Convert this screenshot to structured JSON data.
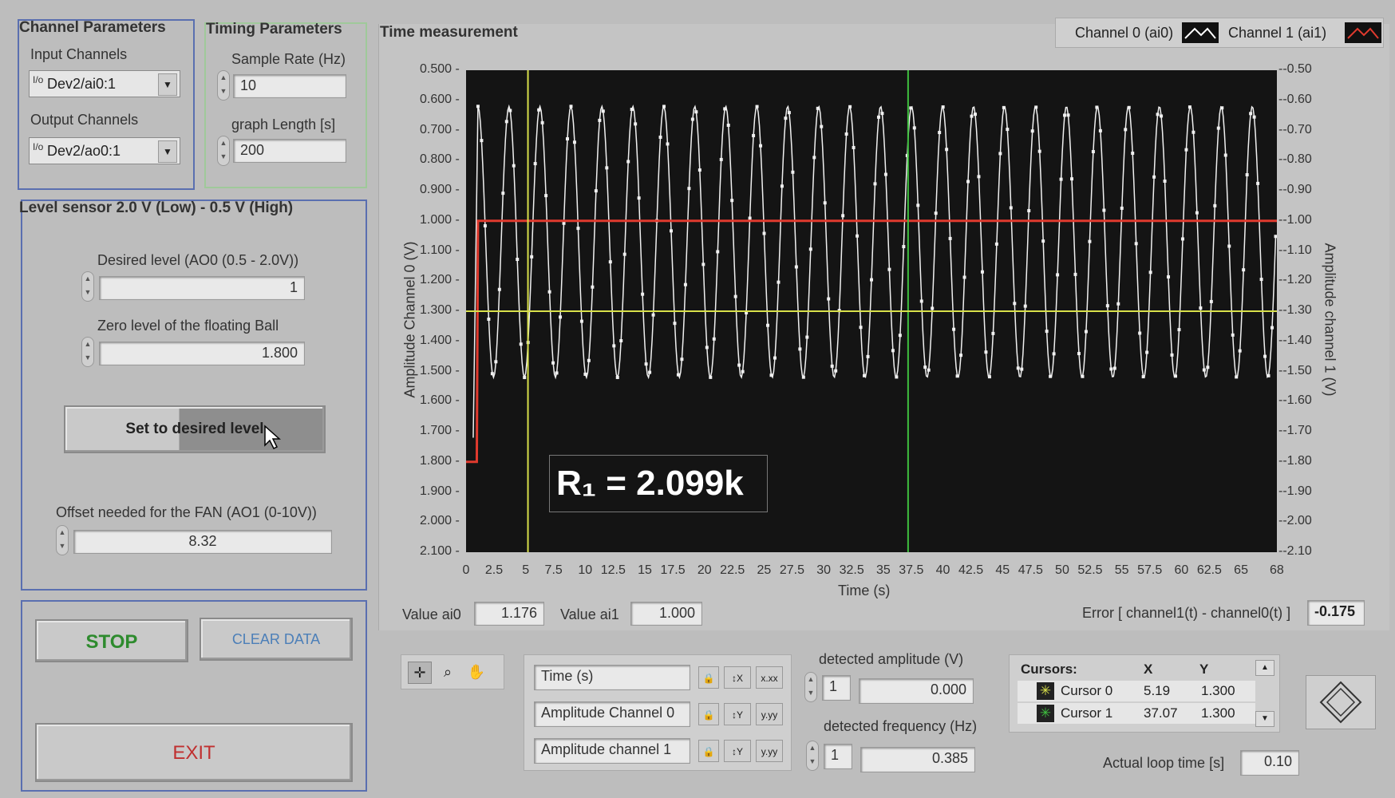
{
  "channel_params": {
    "title": "Channel Parameters",
    "input_label": "Input Channels",
    "input_value": "Dev2/ai0:1",
    "output_label": "Output Channels",
    "output_value": "Dev2/ao0:1"
  },
  "timing_params": {
    "title": "Timing Parameters",
    "sample_rate_label": "Sample Rate (Hz)",
    "sample_rate_value": "10",
    "graph_length_label": "graph Length [s]",
    "graph_length_value": "200"
  },
  "level_panel": {
    "title": "Level sensor 2.0 V (Low) - 0.5 V (High)",
    "desired_label": "Desired level (AO0  (0.5 - 2.0V))",
    "desired_value": "1",
    "zero_label": "Zero level of the floating Ball",
    "zero_value": "1.800",
    "set_button": "Set to desired level",
    "offset_label": "Offset needed for the FAN (AO1  (0-10V))",
    "offset_value": "8.32"
  },
  "buttons": {
    "stop": "STOP",
    "clear": "CLEAR DATA",
    "exit": "EXIT"
  },
  "graph": {
    "title": "Time measurement",
    "legend0": "Channel 0 (ai0)",
    "legend1": "Channel 1 (ai1)",
    "ylabel_left": "Amplitude Channel 0 (V)",
    "ylabel_right": "Amplitude channel 1 (V)",
    "xlabel": "Time (s)",
    "overlay_text": "R₁ = 2.099k",
    "left_ticks": [
      "0.500",
      "0.600",
      "0.700",
      "0.800",
      "0.900",
      "1.000",
      "1.100",
      "1.200",
      "1.300",
      "1.400",
      "1.500",
      "1.600",
      "1.700",
      "1.800",
      "1.900",
      "2.000",
      "2.100"
    ],
    "right_ticks": [
      "-0.50",
      "-0.60",
      "-0.70",
      "-0.80",
      "-0.90",
      "-1.00",
      "-1.10",
      "-1.20",
      "-1.30",
      "-1.40",
      "-1.50",
      "-1.60",
      "-1.70",
      "-1.80",
      "-1.90",
      "-2.00",
      "-2.10"
    ],
    "x_ticks": [
      "0",
      "2.5",
      "5",
      "7.5",
      "10",
      "12.5",
      "15",
      "17.5",
      "20",
      "22.5",
      "25",
      "27.5",
      "30",
      "32.5",
      "35",
      "37.5",
      "40",
      "42.5",
      "45",
      "47.5",
      "50",
      "52.5",
      "55",
      "57.5",
      "60",
      "62.5",
      "65",
      "68"
    ],
    "colors": {
      "background": "#141414",
      "ch0": "#f0f0f0",
      "ch1": "#e03a2e",
      "cursor0": "#d8e04a",
      "cursor1": "#3fbf3f"
    }
  },
  "chart_data": {
    "type": "line",
    "xlabel": "Time (s)",
    "ylabel": "Amplitude Channel 0 (V)",
    "xlim": [
      0,
      68
    ],
    "ylim": [
      0.5,
      2.1
    ],
    "y_inverted": true,
    "series": [
      {
        "name": "Channel 0 (ai0)",
        "shape": "sine",
        "frequency_hz": 0.385,
        "min": 0.62,
        "max": 1.52,
        "start_x": 1.0
      },
      {
        "name": "Channel 1 (ai1)",
        "x": [
          0,
          0.9,
          1.0,
          68
        ],
        "y": [
          1.8,
          1.8,
          1.0,
          1.0
        ]
      }
    ]
  },
  "cursor_lines": {
    "cursor0_x": 5.19,
    "cursor1_x": 37.07,
    "y": 1.3
  },
  "values": {
    "ai0_label": "Value ai0",
    "ai0_value": "1.176",
    "ai1_label": "Value ai1",
    "ai1_value": "1.000",
    "error_label": "Error [ channel1(t) - channel0(t) ]",
    "error_value": "-0.175"
  },
  "scale_legend": {
    "rows": [
      "Time (s)",
      "Amplitude Channel 0",
      "Amplitude channel 1"
    ]
  },
  "detection": {
    "amp_label": "detected amplitude (V)",
    "amp_index": "1",
    "amp_value": "0.000",
    "freq_label": "detected frequency (Hz)",
    "freq_index": "1",
    "freq_value": "0.385"
  },
  "cursors": {
    "header_name": "Cursors:",
    "header_x": "X",
    "header_y": "Y",
    "rows": [
      {
        "name": "Cursor 0",
        "x": "5.19",
        "y": "1.300"
      },
      {
        "name": "Cursor 1",
        "x": "37.07",
        "y": "1.300"
      }
    ]
  },
  "loop": {
    "label": "Actual loop time [s]",
    "value": "0.10"
  }
}
